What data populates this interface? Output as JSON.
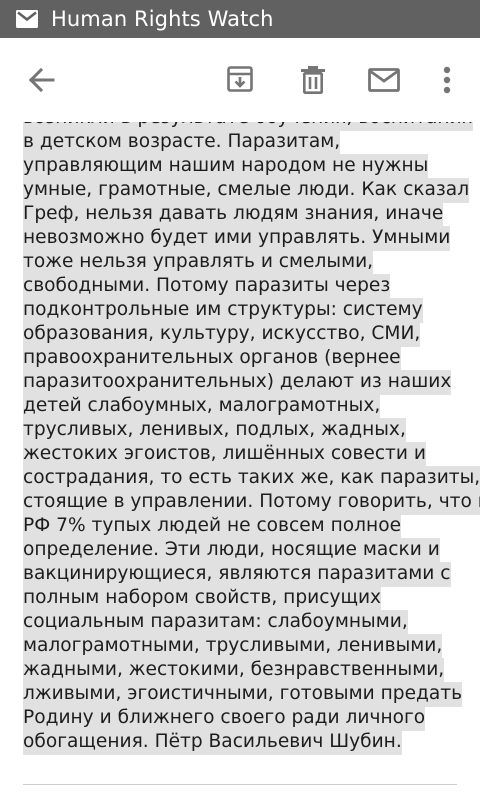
{
  "status_bar": {
    "icon": "gmail-envelope-icon",
    "title": "Human Rights Watch"
  },
  "toolbar": {
    "back_icon": "arrow-back-icon",
    "archive_icon": "archive-icon",
    "delete_icon": "trash-icon",
    "mark_unread_icon": "envelope-icon",
    "overflow_icon": "more-vert-icon"
  },
  "message": {
    "body_lines": [
      "возникли в результате обучения, воспитания",
      "в детском возрасте. Паразитам,",
      "управляющим нашим народом не нужны",
      "умные, грамотные, смелые люди. Как сказал",
      "Греф, нельзя давать людям знания, иначе",
      "невозможно будет ими управлять. Умными",
      "тоже нельзя управлять и смелыми,",
      "свободными. Потому паразиты через",
      "подконтрольные им структуры: систему",
      "образования, культуру, искусство, СМИ,",
      "правоохранительных органов (вернее",
      "паразитоохранительных) делают из наших",
      "детей слабоумных, малограмотных,",
      "трусливых, ленивых, подлых, жадных,",
      "жестоких эгоистов, лишённых совести и",
      "сострадания, то есть таких же, как паразиты,",
      "стоящие в управлении. Потому говорить, что в",
      "РФ 7% тупых людей не совсем полное",
      "определение. Эти люди, носящие маски и",
      "вакцинирующиеся, являются паразитами с",
      "полным набором свойств, присущих",
      "социальным паразитам: слабоумными,",
      "малограмотными, трусливыми, ленивыми,",
      "жадными, жестокими, безнравственными,",
      "лживыми, эгоистичными, готовыми предать",
      "Родину и ближнего своего ради личного",
      "обогащения. Пётр Васильевич Шубин."
    ]
  },
  "colors": {
    "status_bar_bg": "#616161",
    "toolbar_bg": "#ffffff",
    "icon_color": "#757575",
    "highlight": "#e1e1e1",
    "text": "#1d1d1d"
  }
}
